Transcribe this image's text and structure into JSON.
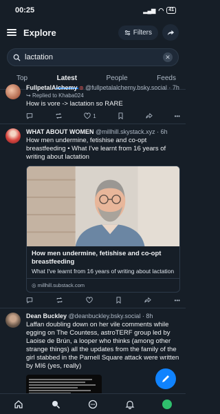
{
  "status": {
    "time": "00:25",
    "battery": "41"
  },
  "header": {
    "title": "Explore",
    "filters_label": "Filters"
  },
  "search": {
    "value": "lactation",
    "placeholder": "Search"
  },
  "tabs": [
    {
      "label": "Top"
    },
    {
      "label": "Latest"
    },
    {
      "label": "People"
    },
    {
      "label": "Feeds"
    }
  ],
  "posts": [
    {
      "author": "FullpetalAlchemy",
      "handle": "@fullpetalalchemy.bsky.social",
      "time": "7h",
      "reply_to": "Replied to Khaba024",
      "text": "How is vore -> lactation so RARE",
      "likes": "1"
    },
    {
      "author": "WHAT ABOUT WOMEN",
      "handle": "@millhill.skystack.xyz",
      "time": "6h",
      "text": "How men undermine, fetishise and co-opt breastfeeding • What I've learnt from 16 years of writing about lactation",
      "link": {
        "title": "How men undermine, fetishise and co-opt breastfeeding",
        "description": "What I've learnt from 16 years of writing about lactation",
        "domain": "millhill.substack.com"
      }
    },
    {
      "author": "Dean Buckley",
      "handle": "@deanbuckley.bsky.social",
      "time": "8h",
      "text": "Laffan doubling down on her vile comments while egging on The Countess, astroTERF group led by Laoise de Brún, a looper who thinks (among other strange things) all the updates from the family of the girl stabbed in the Parnell Square attack were written by MI6 (yes, really)"
    }
  ],
  "colors": {
    "background": "#161e27",
    "accent": "#1083fe",
    "muted": "#aeb9c6"
  }
}
